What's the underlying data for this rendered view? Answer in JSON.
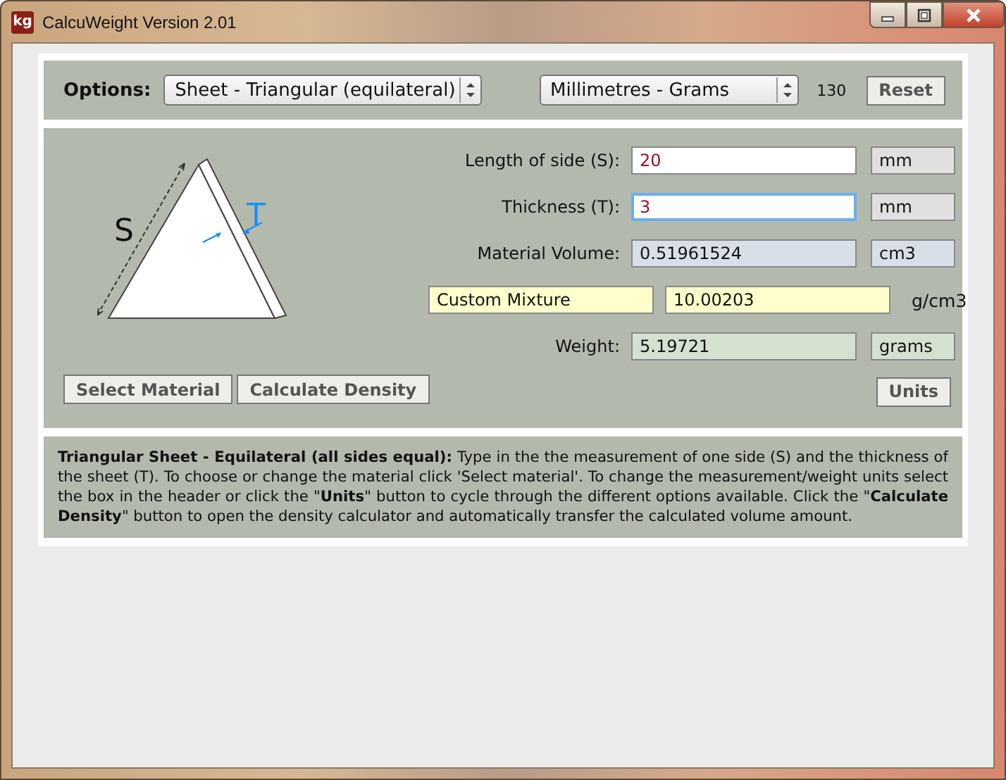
{
  "window": {
    "title": "CalcuWeight Version 2.01",
    "app_icon": "kg"
  },
  "options": {
    "label": "Options:",
    "shape": "Sheet - Triangular (equilateral)",
    "units": "Millimetres - Grams",
    "code": "130",
    "reset": "Reset"
  },
  "diagram": {
    "side_label": "S",
    "thickness_label": "T"
  },
  "rows": [
    {
      "kind": "input",
      "label": "Length of side (S):",
      "value": "20",
      "unit": "mm",
      "focused": false
    },
    {
      "kind": "input",
      "label": "Thickness (T):",
      "value": "3",
      "unit": "mm",
      "focused": true
    },
    {
      "kind": "volume",
      "label": "Material Volume:",
      "value": "0.51961524",
      "unit": "cm3"
    },
    {
      "kind": "density",
      "label": "Custom Mixture",
      "value": "10.00203",
      "unit": "g/cm3"
    },
    {
      "kind": "weight",
      "label": "Weight:",
      "value": "5.19721",
      "unit": "grams"
    }
  ],
  "buttons": [
    "Select Material",
    "Calculate Density"
  ],
  "units_button": "Units",
  "description": "**Triangular Sheet - Equilateral (all sides equal):** Type in the the measurement of one side (S) and the thickness of the sheet (T). To choose or change the material click 'Select material'. To change the measurement/weight units select the box in the header or click the \"**Units**\" button to cycle through the different options available. Click the \"**Calculate Density**\" button to open the density calculator and automatically transfer the calculated volume amount."
}
